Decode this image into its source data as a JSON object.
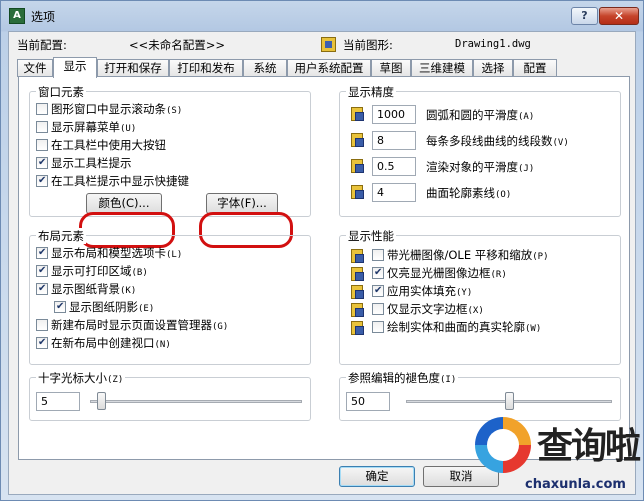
{
  "window": {
    "title": "选项",
    "help": "?",
    "close": "✕",
    "app_icon": "A"
  },
  "info": {
    "config_label": "当前配置:",
    "config_value": "<<未命名配置>>",
    "drawing_label": "当前图形:",
    "drawing_value": "Drawing1.dwg"
  },
  "tabs": [
    "文件",
    "显示",
    "打开和保存",
    "打印和发布",
    "系统",
    "用户系统配置",
    "草图",
    "三维建模",
    "选择",
    "配置"
  ],
  "window_elements": {
    "title": "窗口元素",
    "items": [
      {
        "label": "图形窗口中显示滚动条",
        "key": "(S)",
        "checked": false
      },
      {
        "label": "显示屏幕菜单",
        "key": "(U)",
        "checked": false
      },
      {
        "label": "在工具栏中使用大按钮",
        "key": "",
        "checked": false
      },
      {
        "label": "显示工具栏提示",
        "key": "",
        "checked": true
      },
      {
        "label": "在工具栏提示中显示快捷键",
        "key": "",
        "checked": true
      }
    ],
    "colors_button": "颜色(C)...",
    "fonts_button": "字体(F)..."
  },
  "display_resolution": {
    "title": "显示精度",
    "items": [
      {
        "value": "1000",
        "label": "圆弧和圆的平滑度",
        "key": "(A)"
      },
      {
        "value": "8",
        "label": "每条多段线曲线的线段数",
        "key": "(V)"
      },
      {
        "value": "0.5",
        "label": "渲染对象的平滑度",
        "key": "(J)"
      },
      {
        "value": "4",
        "label": "曲面轮廓素线",
        "key": "(O)"
      }
    ]
  },
  "layout_elements": {
    "title": "布局元素",
    "items": [
      {
        "label": "显示布局和模型选项卡",
        "key": "(L)",
        "checked": true,
        "indent": false
      },
      {
        "label": "显示可打印区域",
        "key": "(B)",
        "checked": true,
        "indent": false
      },
      {
        "label": "显示图纸背景",
        "key": "(K)",
        "checked": true,
        "indent": false
      },
      {
        "label": "显示图纸阴影",
        "key": "(E)",
        "checked": true,
        "indent": true
      },
      {
        "label": "新建布局时显示页面设置管理器",
        "key": "(G)",
        "checked": false,
        "indent": false
      },
      {
        "label": "在新布局中创建视口",
        "key": "(N)",
        "checked": true,
        "indent": false
      }
    ]
  },
  "display_performance": {
    "title": "显示性能",
    "items": [
      {
        "label": "带光栅图像/OLE 平移和缩放",
        "key": "(P)",
        "checked": false
      },
      {
        "label": "仅亮显光栅图像边框",
        "key": "(R)",
        "checked": true
      },
      {
        "label": "应用实体填充",
        "key": "(Y)",
        "checked": true
      },
      {
        "label": "仅显示文字边框",
        "key": "(X)",
        "checked": false
      },
      {
        "label": "绘制实体和曲面的真实轮廓",
        "key": "(W)",
        "checked": false
      }
    ]
  },
  "crosshair": {
    "title": "十字光标大小",
    "key": "(Z)",
    "value": "5",
    "level_percent": 5
  },
  "xref_fade": {
    "title": "参照编辑的褪色度",
    "key": "(I)",
    "value": "50",
    "level_percent": 50
  },
  "footer": {
    "ok": "确定",
    "cancel": "取消"
  },
  "watermark": {
    "text": "查询啦",
    "url": "chaxunla.com"
  }
}
